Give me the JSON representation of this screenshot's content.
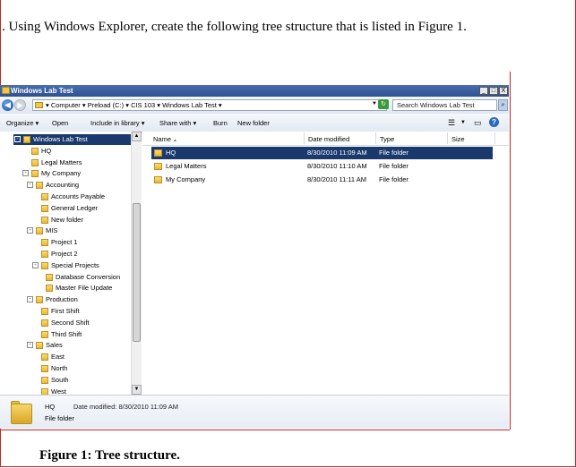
{
  "document": {
    "instruction": ".  Using Windows Explorer, create the following tree structure that is listed in Figure 1.",
    "caption": "Figure 1: Tree structure."
  },
  "window": {
    "title": "Windows Lab Test",
    "controls": {
      "minimize": "_",
      "maximize": "□",
      "close": "X"
    }
  },
  "address_bar": {
    "back_glyph": "◀",
    "forward_glyph": "▶",
    "breadcrumb": "▾ Computer ▾ Preload (C:) ▾ CIS 103 ▾ Windows Lab Test ▾",
    "dropdown_glyph": "▼",
    "search_placeholder": "Search Windows Lab Test"
  },
  "toolbar": {
    "organize": "Organize ▾",
    "open": "Open",
    "include_in_library": "Include in library ▾",
    "share_with": "Share with ▾",
    "burn": "Burn",
    "new_folder": "New folder"
  },
  "tree": [
    {
      "label": "Windows Lab Test",
      "level": 0,
      "expander": "-",
      "selected": true
    },
    {
      "label": "HQ",
      "level": 1,
      "expander": ""
    },
    {
      "label": "Legal Matters",
      "level": 1,
      "expander": ""
    },
    {
      "label": "My Company",
      "level": 1,
      "expander": "-"
    },
    {
      "label": "Accounting",
      "level": 2,
      "expander": "-"
    },
    {
      "label": "Accounts Payable",
      "level": 3,
      "expander": ""
    },
    {
      "label": "General Ledger",
      "level": 3,
      "expander": ""
    },
    {
      "label": "New folder",
      "level": 3,
      "expander": ""
    },
    {
      "label": "MIS",
      "level": 2,
      "expander": "-"
    },
    {
      "label": "Project 1",
      "level": 3,
      "expander": ""
    },
    {
      "label": "Project 2",
      "level": 3,
      "expander": ""
    },
    {
      "label": "Special Projects",
      "level": 3,
      "expander": "-"
    },
    {
      "label": "Database Conversion",
      "level": 4,
      "expander": ""
    },
    {
      "label": "Master File Update",
      "level": 4,
      "expander": ""
    },
    {
      "label": "Production",
      "level": 2,
      "expander": "-"
    },
    {
      "label": "First Shift",
      "level": 3,
      "expander": ""
    },
    {
      "label": "Second Shift",
      "level": 3,
      "expander": ""
    },
    {
      "label": "Third Shift",
      "level": 3,
      "expander": ""
    },
    {
      "label": "Sales",
      "level": 2,
      "expander": "-"
    },
    {
      "label": "East",
      "level": 3,
      "expander": ""
    },
    {
      "label": "North",
      "level": 3,
      "expander": ""
    },
    {
      "label": "South",
      "level": 3,
      "expander": ""
    },
    {
      "label": "West",
      "level": 3,
      "expander": ""
    }
  ],
  "file_list": {
    "columns": {
      "name": "Name",
      "date": "Date modified",
      "type": "Type",
      "size": "Size"
    },
    "rows": [
      {
        "name": "HQ",
        "date": "8/30/2010 11:09 AM",
        "type": "File folder",
        "selected": true
      },
      {
        "name": "Legal Matters",
        "date": "8/30/2010 11:10 AM",
        "type": "File folder"
      },
      {
        "name": "My Company",
        "date": "8/30/2010 11:11 AM",
        "type": "File folder"
      }
    ]
  },
  "details_pane": {
    "name": "HQ",
    "date_modified": "Date modified:  8/30/2010 11:09 AM",
    "type": "File folder"
  },
  "colors": {
    "selection": "#1a3a6e",
    "titlebar": "#2d5090",
    "folder": "#f0c848",
    "frame_red": "#cc2222"
  },
  "icons": [
    "folder-icon",
    "back-arrow-icon",
    "forward-arrow-icon",
    "refresh-icon",
    "search-icon",
    "views-icon",
    "preview-pane-icon",
    "help-icon"
  ]
}
